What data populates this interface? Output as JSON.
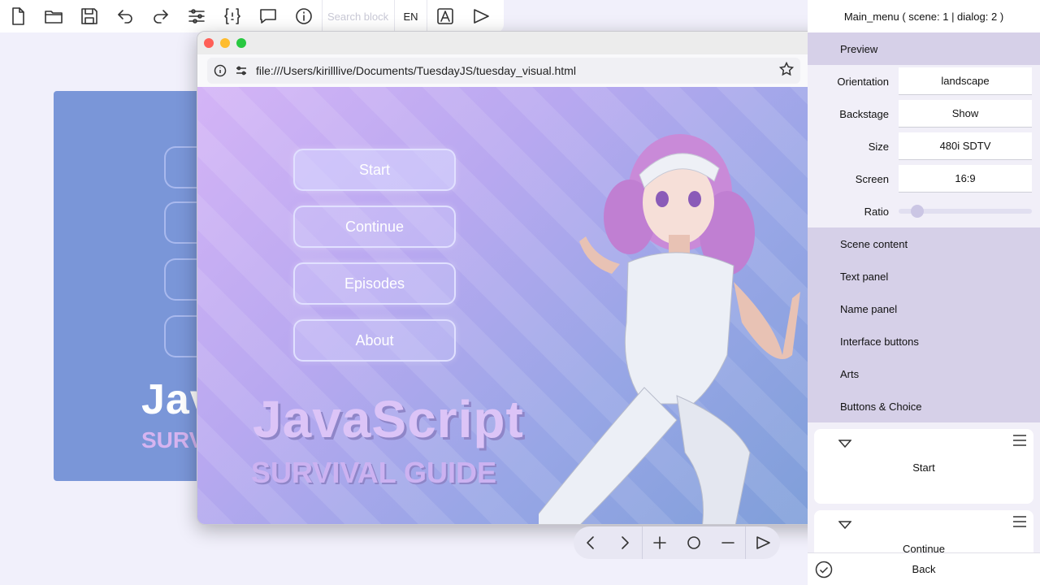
{
  "toolbar": {
    "icons": [
      "new-file-icon",
      "open-folder-icon",
      "save-icon",
      "undo-icon",
      "redo-icon",
      "settings-sliders-icon",
      "code-braces-icon",
      "comment-icon",
      "info-icon",
      "vector-pen-icon",
      "play-icon"
    ],
    "search_placeholder": "Search block",
    "language": "EN"
  },
  "background_canvas": {
    "title": "Jav",
    "subtitle": "SURV"
  },
  "browser": {
    "url": "file:///Users/kirilllive/Documents/TuesdayJS/tuesday_visual.html",
    "menu_buttons": [
      {
        "label": "Start"
      },
      {
        "label": "Continue"
      },
      {
        "label": "Episodes"
      },
      {
        "label": "About"
      }
    ],
    "game_title": "JavaScript",
    "game_subtitle": "SURVIVAL GUIDE"
  },
  "nav": {
    "icons": [
      "chevron-left-icon",
      "chevron-right-icon",
      "plus-icon",
      "circle-icon",
      "minus-icon",
      "play-icon"
    ]
  },
  "panel": {
    "title": "Main_menu ( scene: 1 | dialog: 2 )",
    "preview_label": "Preview",
    "properties": [
      {
        "label": "Orientation",
        "value": "landscape"
      },
      {
        "label": "Backstage",
        "value": "Show"
      },
      {
        "label": "Size",
        "value": "480i SDTV"
      },
      {
        "label": "Screen",
        "value": "16:9"
      }
    ],
    "ratio_label": "Ratio",
    "ratio_value": 0.1,
    "sections": [
      "Scene content",
      "Text panel",
      "Name panel",
      "Interface buttons",
      "Arts",
      "Buttons & Choice"
    ],
    "cards": [
      {
        "label": "Start"
      },
      {
        "label": "Continue"
      }
    ],
    "back_label": "Back"
  },
  "colors": {
    "accent": "#d6d0e8",
    "canvas_bg": "#7a96d8"
  }
}
